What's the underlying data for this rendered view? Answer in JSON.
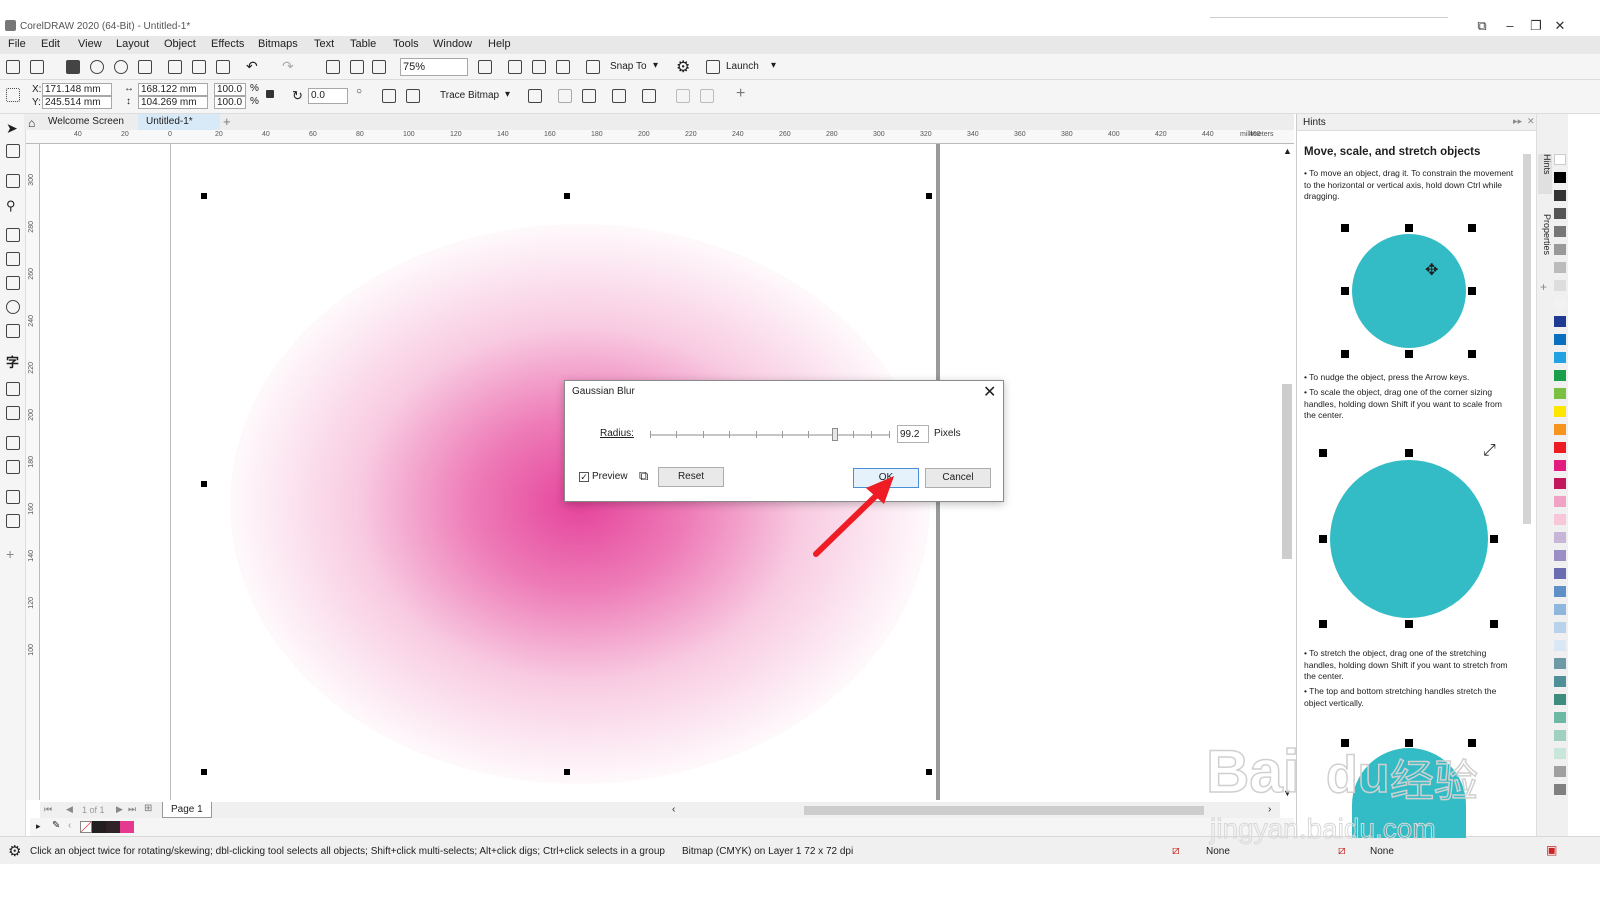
{
  "app": {
    "title": "CorelDRAW 2020 (64-Bit) - Untitled-1*"
  },
  "menu": [
    "File",
    "Edit",
    "View",
    "Layout",
    "Object",
    "Effects",
    "Bitmaps",
    "Text",
    "Table",
    "Tools",
    "Window",
    "Help"
  ],
  "toolbar": {
    "zoom": "75%",
    "snap_to": "Snap To",
    "launch": "Launch"
  },
  "propbar": {
    "x": "171.148 mm",
    "y": "245.514 mm",
    "w": "168.122 mm",
    "h": "104.269 mm",
    "sx": "100.0",
    "sy": "100.0",
    "pct": "%",
    "angle": "0.0",
    "trace_bitmap": "Trace Bitmap",
    "x_label": "X:",
    "y_label": "Y:"
  },
  "tabs": {
    "welcome": "Welcome Screen",
    "doc": "Untitled-1*",
    "add": "+"
  },
  "ruler": {
    "top_ticks": [
      "40",
      "20",
      "0",
      "20",
      "40",
      "60",
      "80",
      "100",
      "120",
      "140",
      "160",
      "180",
      "200",
      "220",
      "240",
      "260",
      "280",
      "300",
      "320",
      "340",
      "360",
      "380",
      "400",
      "420",
      "440",
      "460"
    ],
    "unit": "millimeters",
    "left_ticks": [
      "300",
      "280",
      "260",
      "240",
      "220",
      "200",
      "180",
      "160",
      "140",
      "120",
      "100"
    ]
  },
  "dialog": {
    "title": "Gaussian Blur",
    "radius_label": "Radius:",
    "radius_value": "99.2",
    "unit": "Pixels",
    "preview_label": "Preview",
    "preview_checked": true,
    "reset": "Reset",
    "ok": "OK",
    "cancel": "Cancel",
    "radius_slider_fraction": 0.77
  },
  "pagenav": {
    "count": "1 of 1",
    "page": "Page 1"
  },
  "status": {
    "hint": "Click an object twice for rotating/skewing; dbl-clicking tool selects all objects; Shift+click multi-selects; Alt+click digs; Ctrl+click selects in a group",
    "object": "Bitmap (CMYK) on Layer 1 72 x 72 dpi",
    "fill": "None",
    "outline": "None"
  },
  "hints": {
    "panel_title": "Hints",
    "heading": "Move, scale, and stretch objects",
    "p1": "• To move an object, drag it. To constrain the movement to the horizontal or vertical axis, hold down Ctrl while dragging.",
    "p2": "• To nudge the object, press the Arrow keys.",
    "p3": "• To scale the object, drag one of the corner sizing handles, holding down Shift if you want to scale from the center.",
    "p4": "• To stretch the object, drag one of the stretching handles, holding down Shift if you want to stretch from the center.",
    "p5": "• The top and bottom stretching handles stretch the object vertically."
  },
  "dock_tabs": {
    "hints": "Hints",
    "properties": "Properties"
  },
  "watermark": {
    "brand": "Bai",
    "brand2": "du",
    "cn": "经验",
    "url": "jingyan.baidu.com"
  },
  "colors": {
    "accent_pink": "#e4399a",
    "circle_teal": "#34bcc6",
    "arrow_red": "#ee1c24"
  },
  "palette": [
    "#ffffff",
    "#000000",
    "#333333",
    "#555555",
    "#777777",
    "#999999",
    "#bbbbbb",
    "#dddddd",
    "#f2f2f2",
    "#1f3a93",
    "#0b6fbf",
    "#22a2e0",
    "#1a9e4b",
    "#7ac143",
    "#ffe600",
    "#f7941d",
    "#ed1c24",
    "#e21b7f",
    "#c2185b",
    "#f0a3c5",
    "#f7c6d9",
    "#c8b6d9",
    "#9b8ec4",
    "#6b6bb0",
    "#5f8fc7",
    "#8fb6dd",
    "#b7d2ea",
    "#d9e8f4",
    "#6e9aa7",
    "#4f8f98",
    "#3d8c7d",
    "#6cb8a3",
    "#9fd0c0",
    "#c8e6da",
    "#a0a0a0",
    "#808080"
  ]
}
